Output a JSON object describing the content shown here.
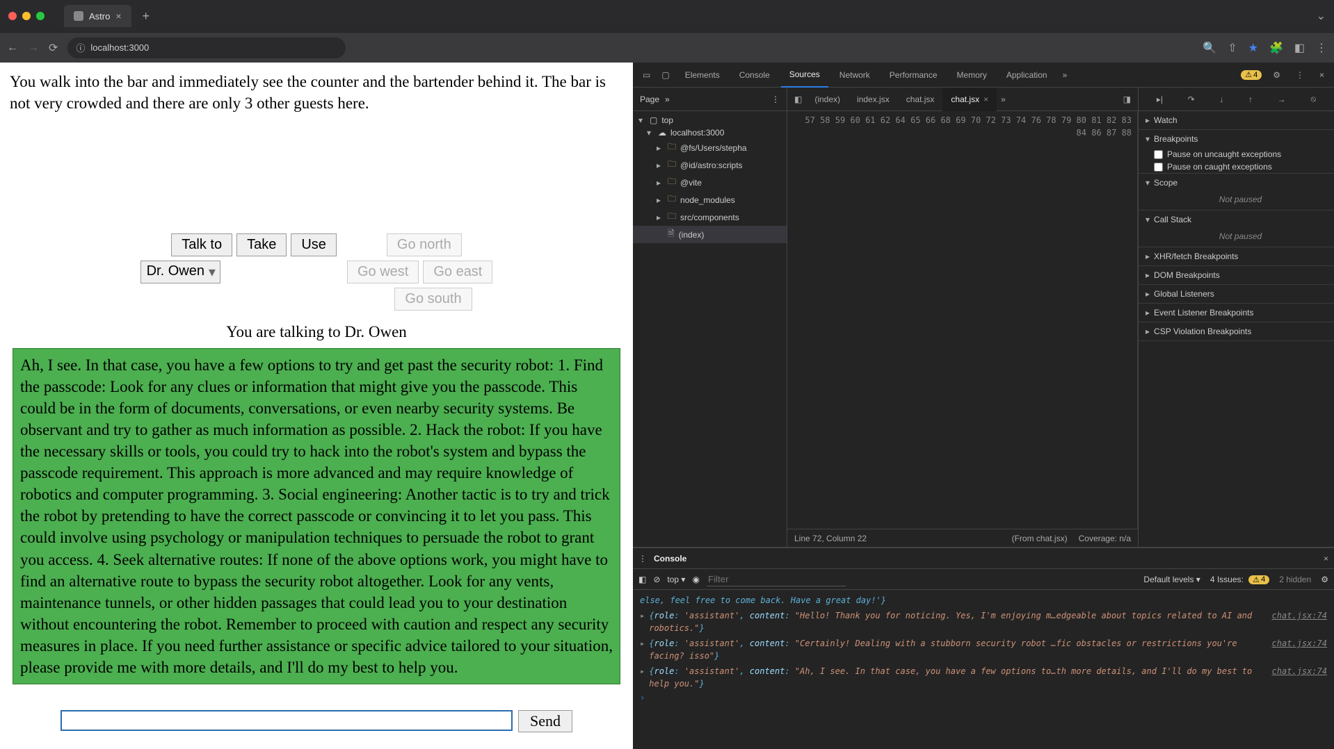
{
  "browser": {
    "tab_title": "Astro",
    "url_display": "localhost:3000",
    "url_full": "localhost:3000"
  },
  "game": {
    "narration": "You walk into the bar and immediately see the counter and the bartender behind it. The bar is not very crowded and there are only 3 other guests here.",
    "buttons": {
      "talk": "Talk to",
      "take": "Take",
      "use": "Use",
      "north": "Go north",
      "west": "Go west",
      "east": "Go east",
      "south": "Go south"
    },
    "dropdown_selected": "Dr. Owen",
    "talking_to": "You are talking to Dr. Owen",
    "assistant_message": "Ah, I see. In that case, you have a few options to try and get past the security robot: 1. Find the passcode: Look for any clues or information that might give you the passcode. This could be in the form of documents, conversations, or even nearby security systems. Be observant and try to gather as much information as possible. 2. Hack the robot: If you have the necessary skills or tools, you could try to hack into the robot's system and bypass the passcode requirement. This approach is more advanced and may require knowledge of robotics and computer programming. 3. Social engineering: Another tactic is to try and trick the robot by pretending to have the correct passcode or convincing it to let you pass. This could involve using psychology or manipulation techniques to persuade the robot to grant you access. 4. Seek alternative routes: If none of the above options work, you might have to find an alternative route to bypass the security robot altogether. Look for any vents, maintenance tunnels, or other hidden passages that could lead you to your destination without encountering the robot. Remember to proceed with caution and respect any security measures in place. If you need further assistance or specific advice tailored to your situation, please provide me with more details, and I'll do my best to help you.",
    "input_value": "",
    "send_label": "Send"
  },
  "devtools": {
    "tabs": [
      "Elements",
      "Console",
      "Sources",
      "Network",
      "Performance",
      "Memory",
      "Application"
    ],
    "active_tab": "Sources",
    "issues_badge": "4",
    "nav": {
      "page_label": "Page",
      "tree": {
        "root": "top",
        "host": "localhost:3000",
        "folders": [
          "@fs/Users/stepha",
          "@id/astro:scripts",
          "@vite",
          "node_modules",
          "src/components"
        ],
        "file": "(index)"
      }
    },
    "editor": {
      "tabs": [
        "(index)",
        "index.jsx",
        "chat.jsx",
        "chat.jsx"
      ],
      "active_tab_index": 3,
      "line_numbers": [
        57,
        58,
        59,
        60,
        61,
        62,
        "",
        64,
        65,
        66,
        "",
        68,
        69,
        70,
        "",
        72,
        73,
        74,
        "",
        76,
        "",
        78,
        79,
        80,
        81,
        82,
        83,
        84,
        "",
        86,
        87,
        88
      ],
      "status_cursor": "Line 72, Column 22",
      "status_from": "(From chat.jsx)",
      "status_coverage": "Coverage: n/a"
    },
    "debugger": {
      "watch": "Watch",
      "breakpoints": "Breakpoints",
      "bp_uncaught": "Pause on uncaught exceptions",
      "bp_caught": "Pause on caught exceptions",
      "scope": "Scope",
      "scope_status": "Not paused",
      "callstack": "Call Stack",
      "callstack_status": "Not paused",
      "xhr": "XHR/fetch Breakpoints",
      "dom_bp": "DOM Breakpoints",
      "global": "Global Listeners",
      "event": "Event Listener Breakpoints",
      "csp": "CSP Violation Breakpoints"
    },
    "console": {
      "title": "Console",
      "context": "top",
      "filter_placeholder": "Filter",
      "levels": "Default levels",
      "issues_label": "4 Issues:",
      "issues_count": "4",
      "hidden": "2 hidden",
      "entries": [
        {
          "text": "else, feel free to come back. Have a great day!'}",
          "src": ""
        },
        {
          "role": "'assistant'",
          "content": "\"Hello! Thank you for noticing. Yes, I'm enjoying m…edgeable about topics related to AI and robotics.\"",
          "src": "chat.jsx:74"
        },
        {
          "role": "'assistant'",
          "content": "\"Certainly! Dealing with a stubborn security robot …fic obstacles or restrictions you're facing? isso\"",
          "src": "chat.jsx:74"
        },
        {
          "role": "'assistant'",
          "content": "\"Ah, I see. In that case, you have a few options to…th more details, and I'll do my best to help you.\"",
          "src": "chat.jsx:74"
        }
      ]
    }
  }
}
